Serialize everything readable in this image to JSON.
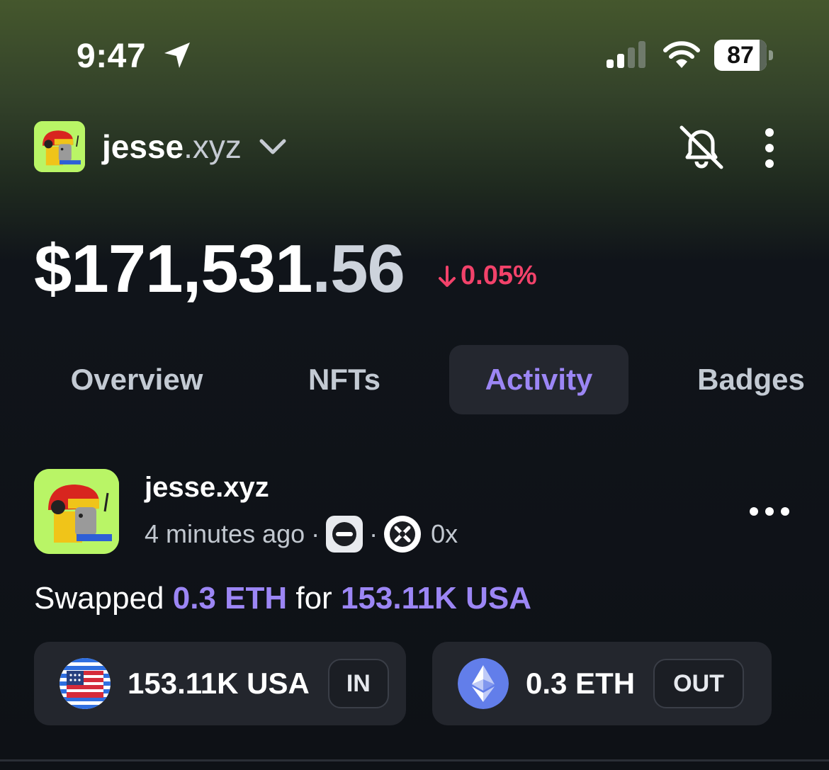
{
  "status_bar": {
    "time": "9:47",
    "battery": "87",
    "icons": [
      "location-arrow-icon",
      "cellular-signal-icon",
      "wifi-icon",
      "battery-icon"
    ]
  },
  "header": {
    "account_name": "jesse",
    "account_suffix": ".xyz",
    "icons": [
      "avatar",
      "chevron-down-icon",
      "bell-off-icon",
      "more-vertical-icon"
    ]
  },
  "balance": {
    "whole": "$171,531",
    "cents": ".56",
    "change": "0.05%",
    "change_direction": "down",
    "change_color": "#f2426a"
  },
  "tabs": [
    {
      "label": "Overview",
      "active": false
    },
    {
      "label": "NFTs",
      "active": false
    },
    {
      "label": "Activity",
      "active": true
    },
    {
      "label": "Badges",
      "active": false
    }
  ],
  "activity": {
    "name": "jesse.xyz",
    "time_ago": "4 minutes ago",
    "protocol": "0x",
    "description": {
      "prefix": "Swapped",
      "amount_out": "0.3 ETH",
      "middle": "for",
      "amount_in": "153.11K USA"
    },
    "tokens": [
      {
        "label": "153.11K USA",
        "direction": "IN",
        "icon": "us-flag-icon"
      },
      {
        "label": "0.3 ETH",
        "direction": "OUT",
        "icon": "ethereum-icon"
      }
    ]
  },
  "colors": {
    "accent": "#9c86f5",
    "negative": "#f2426a",
    "card": "#23262d",
    "background": "#0e1116"
  }
}
